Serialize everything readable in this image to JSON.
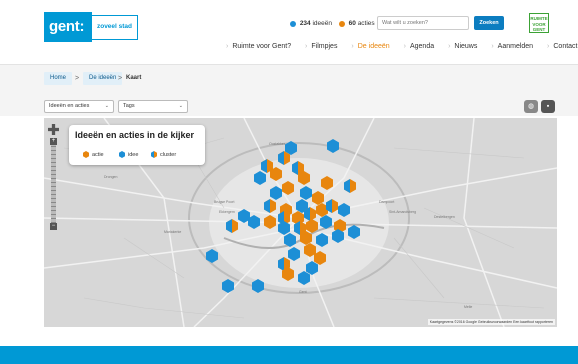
{
  "colors": {
    "brand_blue": "#0099d5",
    "actie": "#e8860e",
    "idee": "#1d8fd6",
    "cluster_gray": "#9a9a9a",
    "rvg_green": "#3ca235"
  },
  "header": {
    "logo_main": "gent:",
    "logo_tag": "zoveel stad",
    "ideas_count": "234",
    "ideas_label": "ideeën",
    "actions_count": "60",
    "actions_label": "acties",
    "search_placeholder": "Wat wilt u zoeken?",
    "search_button": "Zoeken",
    "rvg_logo": "RUIMTE VOOR GENT",
    "nav": [
      "Ruimte voor Gent?",
      "Filmpjes",
      "De ideeën",
      "Agenda",
      "Nieuws",
      "Aanmelden",
      "Contact"
    ],
    "nav_active_index": 2
  },
  "breadcrumb": {
    "home": "Home",
    "ideas": "De ideeën",
    "current": "Kaart",
    "separator": ">"
  },
  "filters": {
    "type_select": "Ideeën en acties",
    "tags_select": "Tags",
    "globe_icon": "globe-icon",
    "grid_icon": "grid-icon"
  },
  "map": {
    "legend_title": "Ideeën en acties in de kijker",
    "legend_items": [
      {
        "label": "actie",
        "color": "#e8860e"
      },
      {
        "label": "idee",
        "color": "#1d8fd6"
      },
      {
        "label": "cluster",
        "color": "cluster"
      }
    ],
    "copyright": "Kaartgegevens ©2016 Google   Gebruiksvoorwaarden   Een kaartfout rapporteren",
    "zoom_in": "+",
    "zoom_out": "−"
  }
}
